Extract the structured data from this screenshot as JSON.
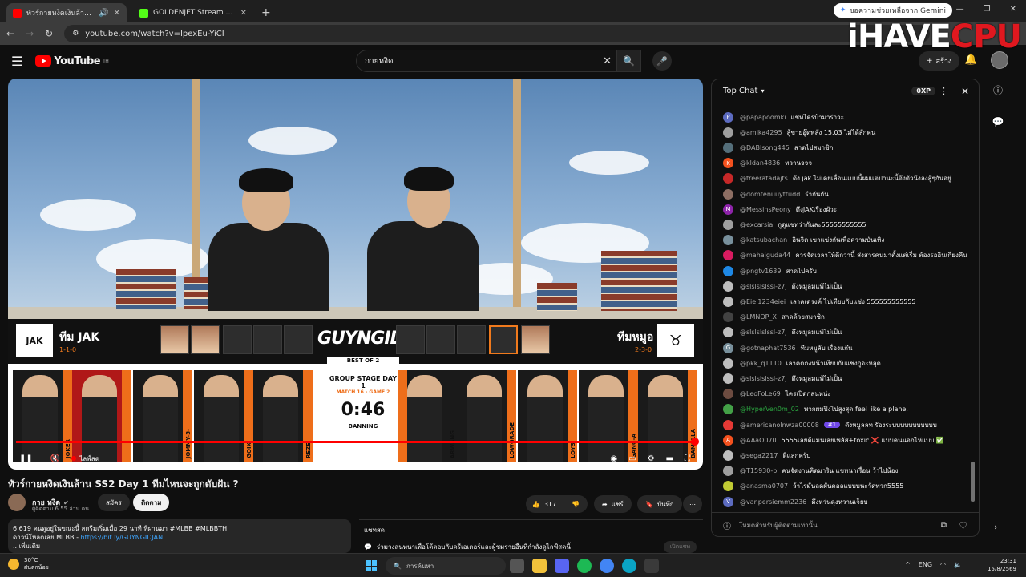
{
  "browser": {
    "tabs": [
      {
        "title": "ทัวร์กายหงิดเงินล้าน SS2 Day 1",
        "active": true,
        "favicon_color": "#ff0000"
      },
      {
        "title": "GOLDENJET Stream - Watch Li...",
        "active": false,
        "favicon_color": "#53fc18"
      }
    ],
    "new_tab": "+",
    "gemini": "ขอความช่วยเหลือจาก Gemini",
    "url": "youtube.com/watch?v=IpexEu-YiCI"
  },
  "watermark": {
    "part1": "iHAVE",
    "part2": "CPU"
  },
  "youtube": {
    "logo_text": "YouTube",
    "region": "TH",
    "search_value": "กายหงิด",
    "create_label": "สร้าง"
  },
  "overlay": {
    "left_team": {
      "name": "ทีม JAK",
      "score": "1-1-0",
      "logo": "JAK"
    },
    "right_team": {
      "name": "ทีมหมูอ",
      "score": "2-3-0"
    },
    "brand": "GUYNGID",
    "best_of": "BEST OF 2",
    "stage": "GROUP STAGE DAY 1",
    "match": "MATCH 16 - GAME 2",
    "timer": "0:46",
    "phase": "BANNING",
    "left_players": [
      "JOKER",
      "JOMMY-3-",
      "GOIX",
      "REZE",
      "XERASHI"
    ],
    "right_players": [
      "ARWANG",
      "LOWGRADE",
      "LOYS",
      "GANG-A",
      "BAMELLA"
    ]
  },
  "player": {
    "live_label": "ไลฟ์สด",
    "progress": 1.0
  },
  "video": {
    "title": "ทัวร์กายหงิดเงินล้าน SS2 Day 1 ทีมไหนจะถูกดับฝัน ?",
    "channel": "กาย หงิด",
    "subscribers": "ผู้ติดตาม 6.55 ล้าน คน",
    "join_label": "สมัคร",
    "subscribe_label": "ติดตาม",
    "likes": "317",
    "share_label": "แชร์",
    "save_label": "บันทึก",
    "description_line1": "6,619 คนดูอยู่ในขณะนี้  สตรีมเริ่มเมื่อ 29 นาที ที่ผ่านมา  #MLBB #MLBBTH",
    "description_line2_prefix": "ดาวน์โหลดเลย MLBB - ",
    "description_link": "https://bit.ly/GUYNGIDJAN",
    "description_more": "...เพิ่มเติม"
  },
  "chat_recap": {
    "title": "แชทสด",
    "text": "ร่วมวงสนทนาเพื่อโต้ตอบกับครีเอเตอร์และผู้ชมรายอื่นที่กำลังดูไลฟ์สดนี้",
    "tag": "เปิดแชท"
  },
  "chat": {
    "header": "Top Chat",
    "xp": "0XP",
    "input_placeholder": "โหมดสำหรับผู้ติดตามเท่านั้น",
    "messages": [
      {
        "author": "@papapoomki",
        "text": "แชทไครบ้ามาร่าวะ",
        "color": "#5c6bc0",
        "initial": "P"
      },
      {
        "author": "@amika4295",
        "text": "สู้ขายอู๊ดพลัง 15.03 ไม่ได้สักคน",
        "color": "#9e9e9e",
        "initial": ""
      },
      {
        "author": "@DABIsong445",
        "text": "สาดไปสมาชิก",
        "color": "#546e7a",
        "initial": ""
      },
      {
        "author": "@kldan4836",
        "text": "หวานจจจ",
        "color": "#f4511e",
        "initial": "K"
      },
      {
        "author": "@treeratadajts",
        "text": "ดึง jak ไม่เคยเลื่อนแบบนี้ผมแต่ปานะนี้ดึงตัวนึงลงสู้ๆกันอยู่",
        "color": "#c62828",
        "initial": ""
      },
      {
        "author": "@domtenuuyttudd",
        "text": "รำกันกัน",
        "color": "#8d6e63",
        "initial": ""
      },
      {
        "author": "@MessinsPeony",
        "text": "ดึงJAKเรื่องผัวะ",
        "color": "#8e24aa",
        "initial": "M"
      },
      {
        "author": "@excarsia",
        "text": "กูดูแชทว่ากันละ55555555555",
        "color": "#9e9e9e",
        "initial": ""
      },
      {
        "author": "@katsubachan",
        "text": "อินจิต เขาแข่งกันเพื่อความบันเทิง",
        "color": "#78909c",
        "initial": ""
      },
      {
        "author": "@mahaiguda44",
        "text": "ควรจัดเวลาให้ดีกว่านี้ ส่งสารคนมาตั้งแต่เริ่ม ต้องรออินเกี่ยงคืน",
        "color": "#d81b60",
        "initial": ""
      },
      {
        "author": "@pngtv1639",
        "text": "สาดไปครับ",
        "color": "#1e88e5",
        "initial": ""
      },
      {
        "author": "@slslslslssl-z7j",
        "text": "ดึงหมูลมแพ้ไม่เป็น",
        "color": "#bdbdbd",
        "initial": ""
      },
      {
        "author": "@Eiei1234eiei",
        "text": "เลาคเดรงค์ ไปเทียบกับแช่ง 555555555555",
        "color": "#bdbdbd",
        "initial": ""
      },
      {
        "author": "@LMNOP_X",
        "text": "สาดด้วยสมาชิก",
        "color": "#424242",
        "initial": ""
      },
      {
        "author": "@slslslslssl-z7j",
        "text": "ดึงหมูลมแพ้ไม่เป็น",
        "color": "#bdbdbd",
        "initial": ""
      },
      {
        "author": "@gotnaphat7536",
        "text": "ทีมหมูลับ เรื่องแก๊น",
        "color": "#78909c",
        "initial": "G"
      },
      {
        "author": "@pkk_q1110",
        "text": "เลาคดกงหน้าเทียบกับแช่งกูจะหลุด",
        "color": "#bdbdbd",
        "initial": ""
      },
      {
        "author": "@slslslslssl-z7j",
        "text": "ดึงหมูลมแพ้ไม่เป็น",
        "color": "#bdbdbd",
        "initial": ""
      },
      {
        "author": "@LeoFoLe69",
        "text": "ไครเปิดกลนหน่ะ",
        "color": "#6d4c41",
        "initial": ""
      },
      {
        "author": "@HyperVen0m_02",
        "text": "พวกผมปิงไปสูงสุด feel like a plane.",
        "color": "#43a047",
        "initial": "",
        "author_color": "#2ba640"
      },
      {
        "author": "@americanolnwza00008",
        "text": "ดึงหมูลลท รัองระบบบบบบบบบบบ",
        "color": "#e53935",
        "initial": "",
        "badge": "#1"
      },
      {
        "author": "@AAaO070",
        "text": "5555เลยดีแมนเลยเพลัส+toxic ❌ แบบคนนอกไห่แบบ ✅",
        "color": "#f4511e",
        "initial": "A"
      },
      {
        "author": "@sega2217",
        "text": "ดีแสกครับ",
        "color": "#bdbdbd",
        "initial": ""
      },
      {
        "author": "@T15930-b",
        "text": "คนจัดงานคิดมาริน แขทนาเรื่อน ว้าไปน้อง",
        "color": "#9e9e9e",
        "initial": ""
      },
      {
        "author": "@anasma0707",
        "text": "ว้าไร่มันลดผันคอลแบบบนะวัดพวก5555",
        "color": "#c0ca33",
        "initial": ""
      },
      {
        "author": "@vanpersiemm2236",
        "text": "ดึงหว่นดุงหวานเจ็ยบ",
        "color": "#5c6bc0",
        "initial": "V"
      }
    ]
  },
  "taskbar": {
    "temperature": "30°C",
    "weather_text": "ฝนตกน้อย",
    "search_placeholder": "การค้นหา",
    "language": "ENG",
    "time": "23:31",
    "date": "15/8/2569"
  }
}
